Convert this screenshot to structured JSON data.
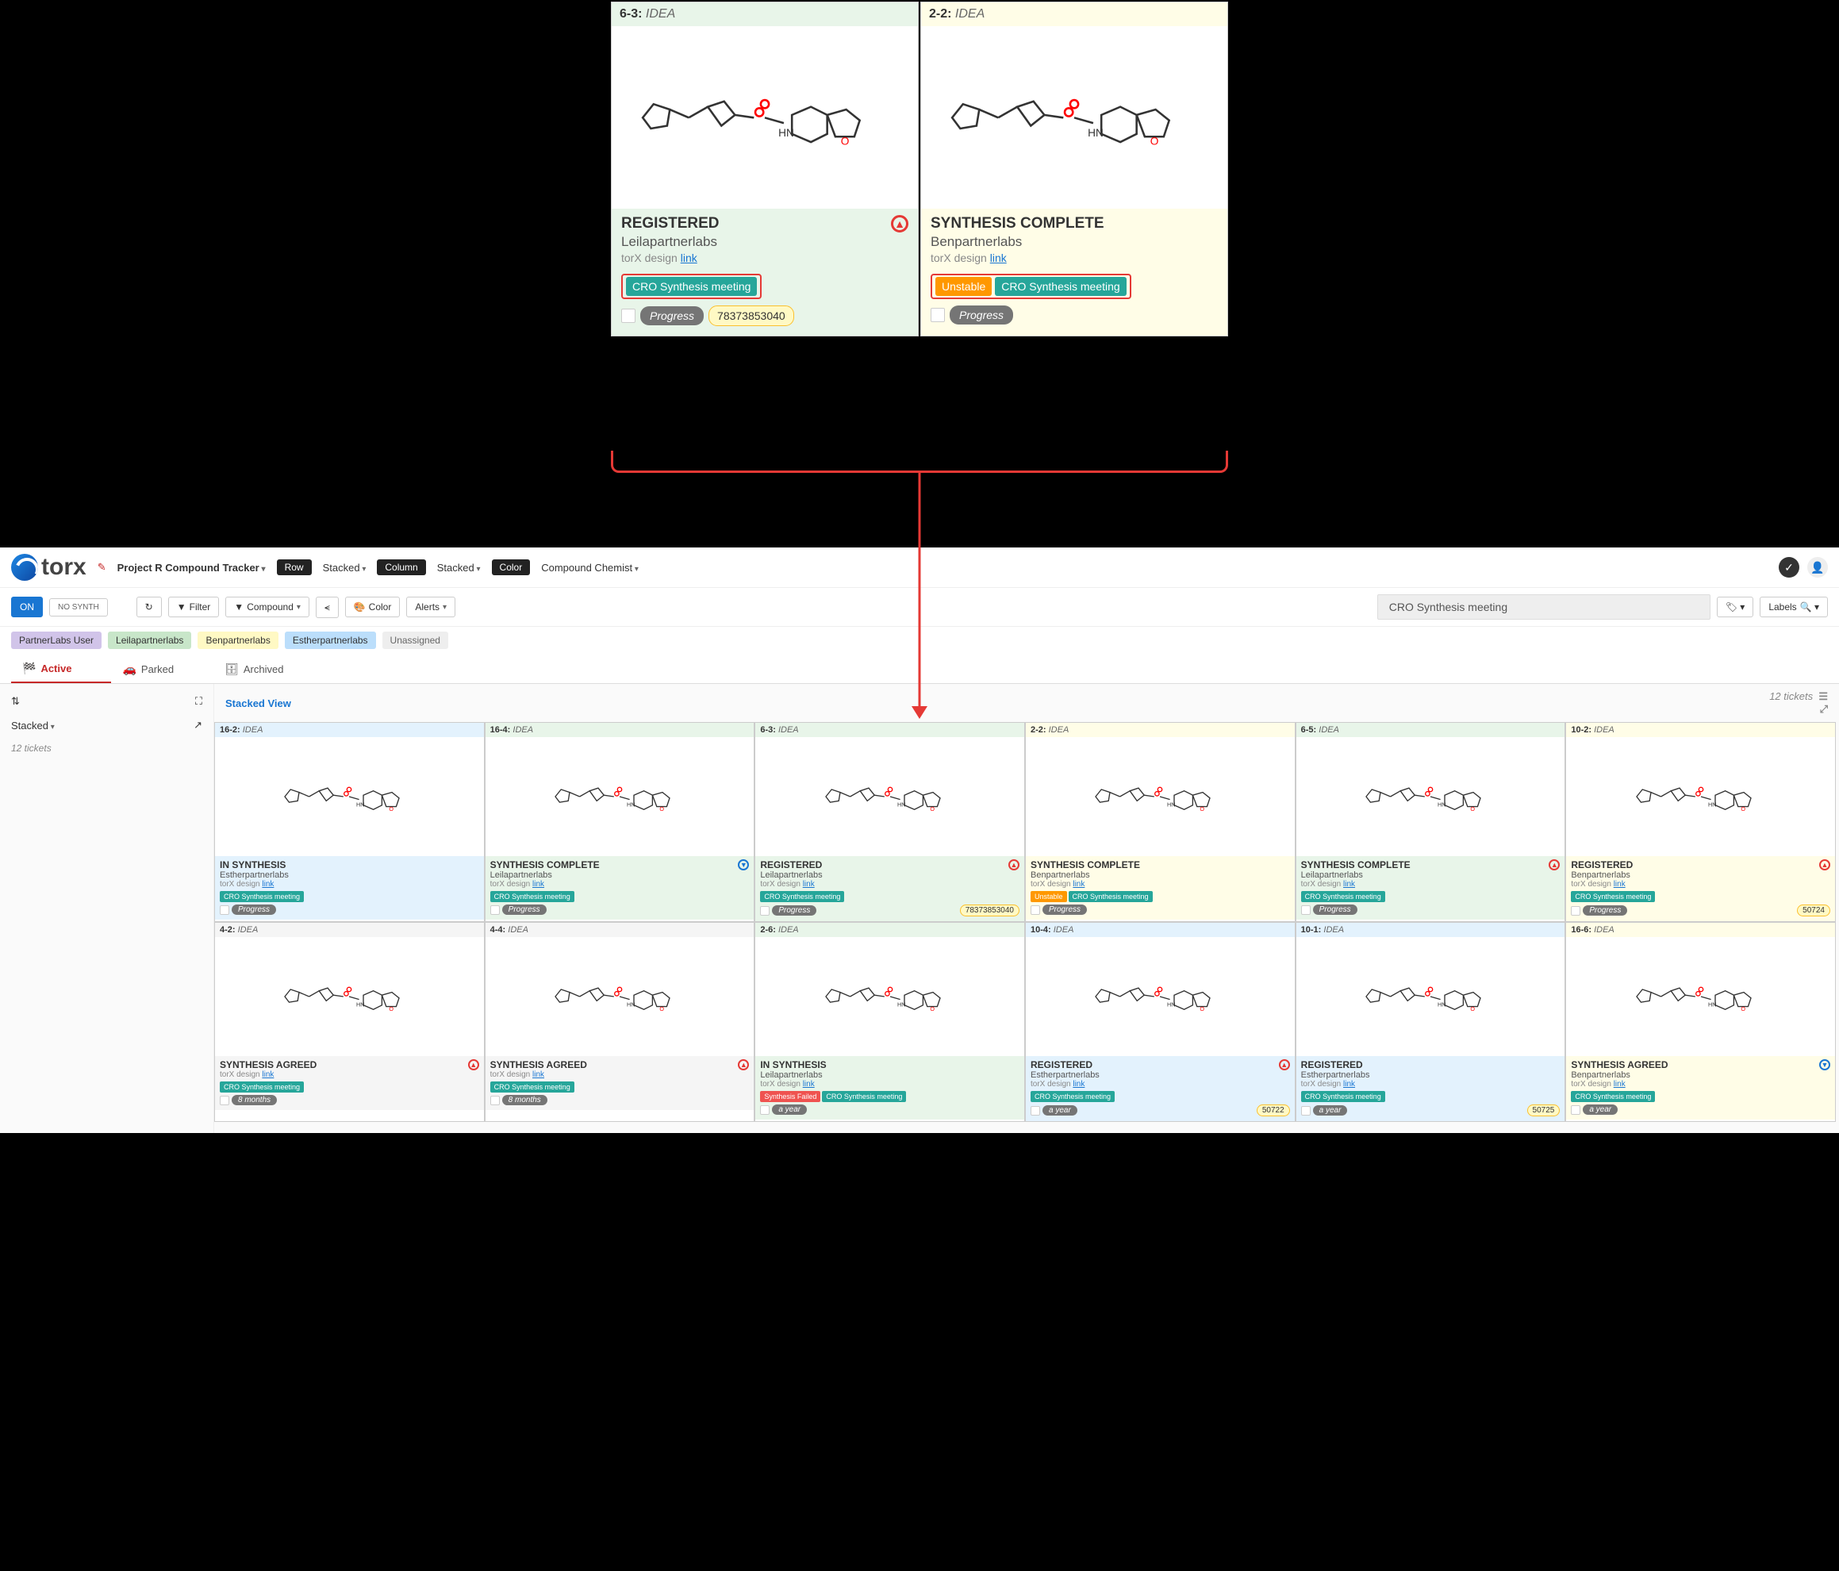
{
  "zoom_cards": [
    {
      "id": "6-3",
      "category": "IDEA",
      "status": "REGISTERED",
      "chemist": "Leilapartnerlabs",
      "design_label": "torX design",
      "link": "link",
      "tags": [
        {
          "text": "CRO Synthesis meeting",
          "cls": "green"
        }
      ],
      "footer": "Progress",
      "id_badge": "78373853040",
      "bg": "green",
      "arrow": "up"
    },
    {
      "id": "2-2",
      "category": "IDEA",
      "status": "SYNTHESIS COMPLETE",
      "chemist": "Benpartnerlabs",
      "design_label": "torX design",
      "link": "link",
      "tags": [
        {
          "text": "Unstable",
          "cls": "orange"
        },
        {
          "text": "CRO Synthesis meeting",
          "cls": "green"
        }
      ],
      "footer": "Progress",
      "bg": "yellow"
    }
  ],
  "app": {
    "logo": "torx",
    "project": "Project R Compound Tracker",
    "row_label": "Row",
    "row_val": "Stacked",
    "col_label": "Column",
    "col_val": "Stacked",
    "color_label": "Color",
    "color_val": "Compound Chemist"
  },
  "toolbar": {
    "on": "ON",
    "nosynth": "NO SYNTH",
    "filter": "Filter",
    "compound": "Compound",
    "color": "Color",
    "alerts": "Alerts",
    "search": "CRO Synthesis meeting",
    "labels": "Labels"
  },
  "chips": [
    "PartnerLabs User",
    "Leilapartnerlabs",
    "Benpartnerlabs",
    "Estherpartnerlabs",
    "Unassigned"
  ],
  "chip_classes": [
    "purple",
    "green",
    "yellow",
    "blue",
    "gray"
  ],
  "tabs": {
    "active": "Active",
    "parked": "Parked",
    "archived": "Archived"
  },
  "left": {
    "stacked": "Stacked",
    "count": "12 tickets"
  },
  "stacked_header": {
    "title": "Stacked View",
    "count": "12 tickets"
  },
  "cards": [
    {
      "id": "16-2",
      "cat": "IDEA",
      "status": "IN SYNTHESIS",
      "chem": "Estherpartnerlabs",
      "tags": [
        {
          "t": "CRO Synthesis meeting",
          "c": "green"
        }
      ],
      "foot": "Progress",
      "bg": "blue"
    },
    {
      "id": "16-4",
      "cat": "IDEA",
      "status": "SYNTHESIS COMPLETE",
      "chem": "Leilapartnerlabs",
      "tags": [
        {
          "t": "CRO Synthesis meeting",
          "c": "green"
        }
      ],
      "foot": "Progress",
      "bg": "green",
      "arrow": "down"
    },
    {
      "id": "6-3",
      "cat": "IDEA",
      "status": "REGISTERED",
      "chem": "Leilapartnerlabs",
      "tags": [
        {
          "t": "CRO Synthesis meeting",
          "c": "green"
        }
      ],
      "foot": "Progress",
      "idb": "78373853040",
      "bg": "green",
      "arrow": "up"
    },
    {
      "id": "2-2",
      "cat": "IDEA",
      "status": "SYNTHESIS COMPLETE",
      "chem": "Benpartnerlabs",
      "tags": [
        {
          "t": "Unstable",
          "c": "orange"
        },
        {
          "t": "CRO Synthesis meeting",
          "c": "green"
        }
      ],
      "foot": "Progress",
      "bg": "yellow"
    },
    {
      "id": "6-5",
      "cat": "IDEA",
      "status": "SYNTHESIS COMPLETE",
      "chem": "Leilapartnerlabs",
      "tags": [
        {
          "t": "CRO Synthesis meeting",
          "c": "green"
        }
      ],
      "foot": "Progress",
      "bg": "green",
      "arrow": "up"
    },
    {
      "id": "10-2",
      "cat": "IDEA",
      "status": "REGISTERED",
      "chem": "Benpartnerlabs",
      "tags": [
        {
          "t": "CRO Synthesis meeting",
          "c": "green"
        }
      ],
      "foot": "Progress",
      "idb": "50724",
      "bg": "yellow",
      "arrow": "up"
    },
    {
      "id": "4-2",
      "cat": "IDEA",
      "status": "SYNTHESIS AGREED",
      "chem": "",
      "tags": [
        {
          "t": "CRO Synthesis meeting",
          "c": "green"
        }
      ],
      "foot": "8 months",
      "bg": "gray",
      "arrow": "up"
    },
    {
      "id": "4-4",
      "cat": "IDEA",
      "status": "SYNTHESIS AGREED",
      "chem": "",
      "tags": [
        {
          "t": "CRO Synthesis meeting",
          "c": "green"
        }
      ],
      "foot": "8 months",
      "bg": "gray",
      "arrow": "up"
    },
    {
      "id": "2-6",
      "cat": "IDEA",
      "status": "IN SYNTHESIS",
      "chem": "Leilapartnerlabs",
      "tags": [
        {
          "t": "Synthesis Failed",
          "c": "red"
        },
        {
          "t": "CRO Synthesis meeting",
          "c": "green"
        }
      ],
      "foot": "a year",
      "bg": "green"
    },
    {
      "id": "10-4",
      "cat": "IDEA",
      "status": "REGISTERED",
      "chem": "Estherpartnerlabs",
      "tags": [
        {
          "t": "CRO Synthesis meeting",
          "c": "green"
        }
      ],
      "foot": "a year",
      "idb": "50722",
      "bg": "blue",
      "arrow": "up"
    },
    {
      "id": "10-1",
      "cat": "IDEA",
      "status": "REGISTERED",
      "chem": "Estherpartnerlabs",
      "tags": [
        {
          "t": "CRO Synthesis meeting",
          "c": "green"
        }
      ],
      "foot": "a year",
      "idb": "50725",
      "bg": "blue"
    },
    {
      "id": "16-6",
      "cat": "IDEA",
      "status": "SYNTHESIS AGREED",
      "chem": "Benpartnerlabs",
      "tags": [
        {
          "t": "CRO Synthesis meeting",
          "c": "green"
        }
      ],
      "foot": "a year",
      "bg": "yellow",
      "arrow": "down"
    }
  ],
  "common": {
    "design": "torX design",
    "link": "link"
  }
}
